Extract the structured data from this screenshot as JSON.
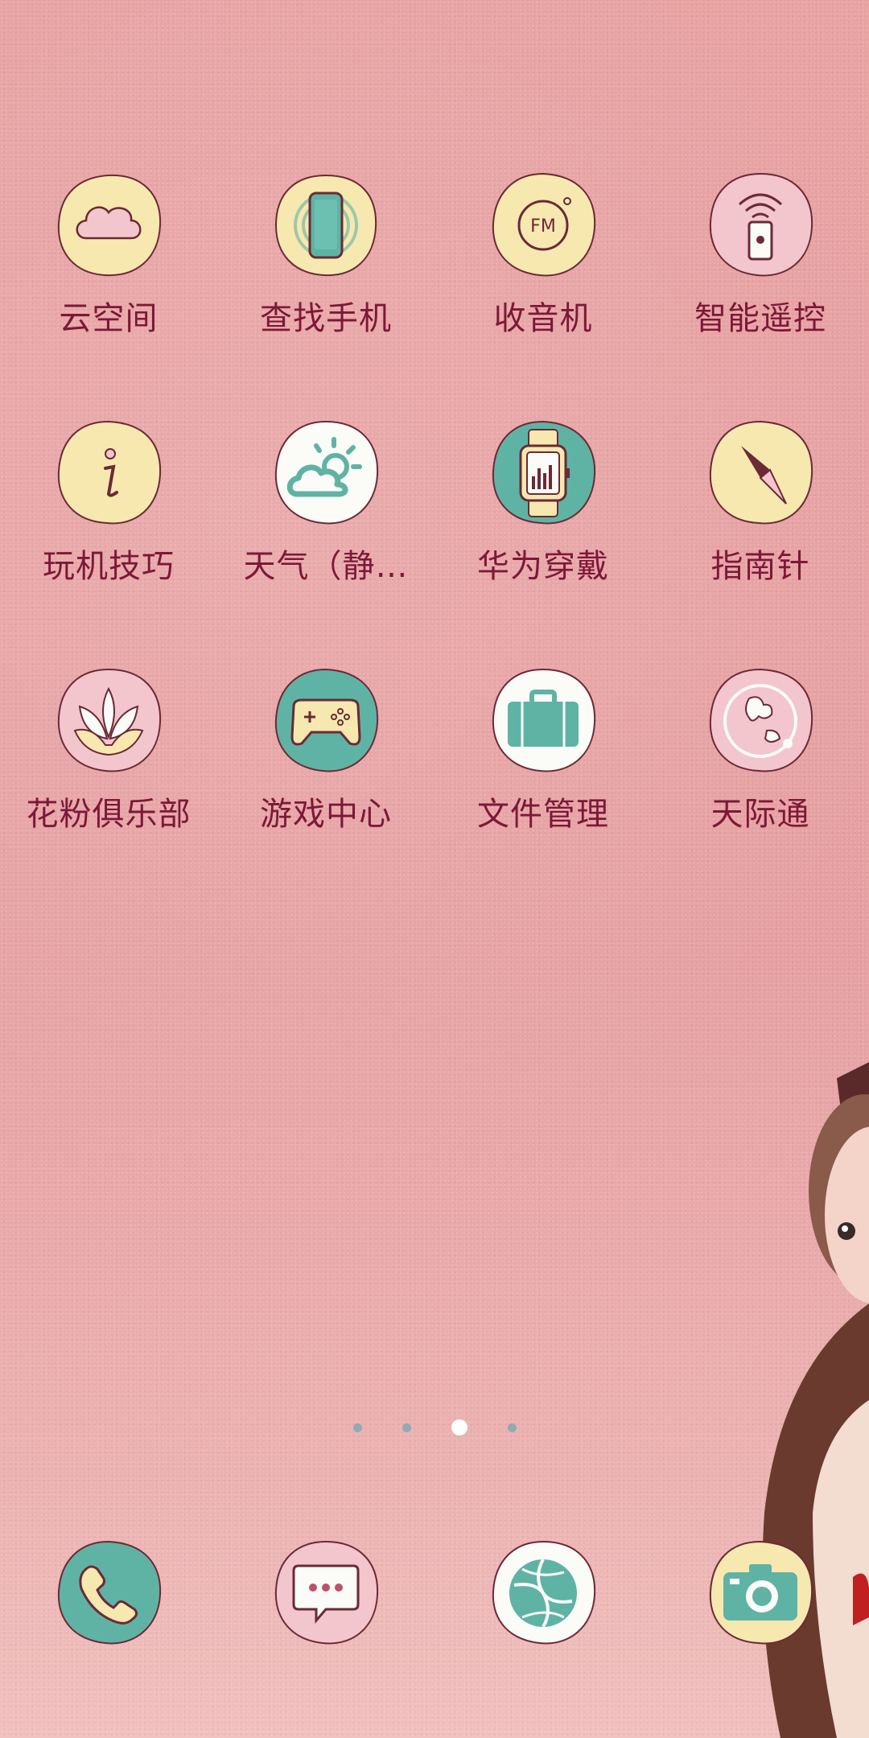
{
  "apps_row1": [
    {
      "label": "云空间",
      "icon": "cloud-icon"
    },
    {
      "label": "查找手机",
      "icon": "find-phone-icon"
    },
    {
      "label": "收音机",
      "icon": "fm-radio-icon"
    },
    {
      "label": "智能遥控",
      "icon": "remote-control-icon"
    }
  ],
  "apps_row2": [
    {
      "label": "玩机技巧",
      "icon": "info-tips-icon"
    },
    {
      "label": "天气（静…",
      "icon": "weather-icon"
    },
    {
      "label": "华为穿戴",
      "icon": "smartwatch-icon"
    },
    {
      "label": "指南针",
      "icon": "compass-icon"
    }
  ],
  "apps_row3": [
    {
      "label": "花粉俱乐部",
      "icon": "lotus-club-icon"
    },
    {
      "label": "游戏中心",
      "icon": "gamepad-icon"
    },
    {
      "label": "文件管理",
      "icon": "briefcase-files-icon"
    },
    {
      "label": "天际通",
      "icon": "globe-roaming-icon"
    }
  ],
  "dock": [
    {
      "label": "",
      "icon": "phone-icon"
    },
    {
      "label": "",
      "icon": "messages-icon"
    },
    {
      "label": "",
      "icon": "browser-icon"
    },
    {
      "label": "",
      "icon": "camera-icon"
    }
  ],
  "page_indicator": {
    "pages": 4,
    "active": 3
  },
  "fm_text": "FM",
  "colors": {
    "label": "#7d1838",
    "teal": "#5fb3a5",
    "cream": "#f7e8b0",
    "pink": "#f3c5cc",
    "white": "#fbfbf8",
    "outline": "#6a2a36"
  }
}
